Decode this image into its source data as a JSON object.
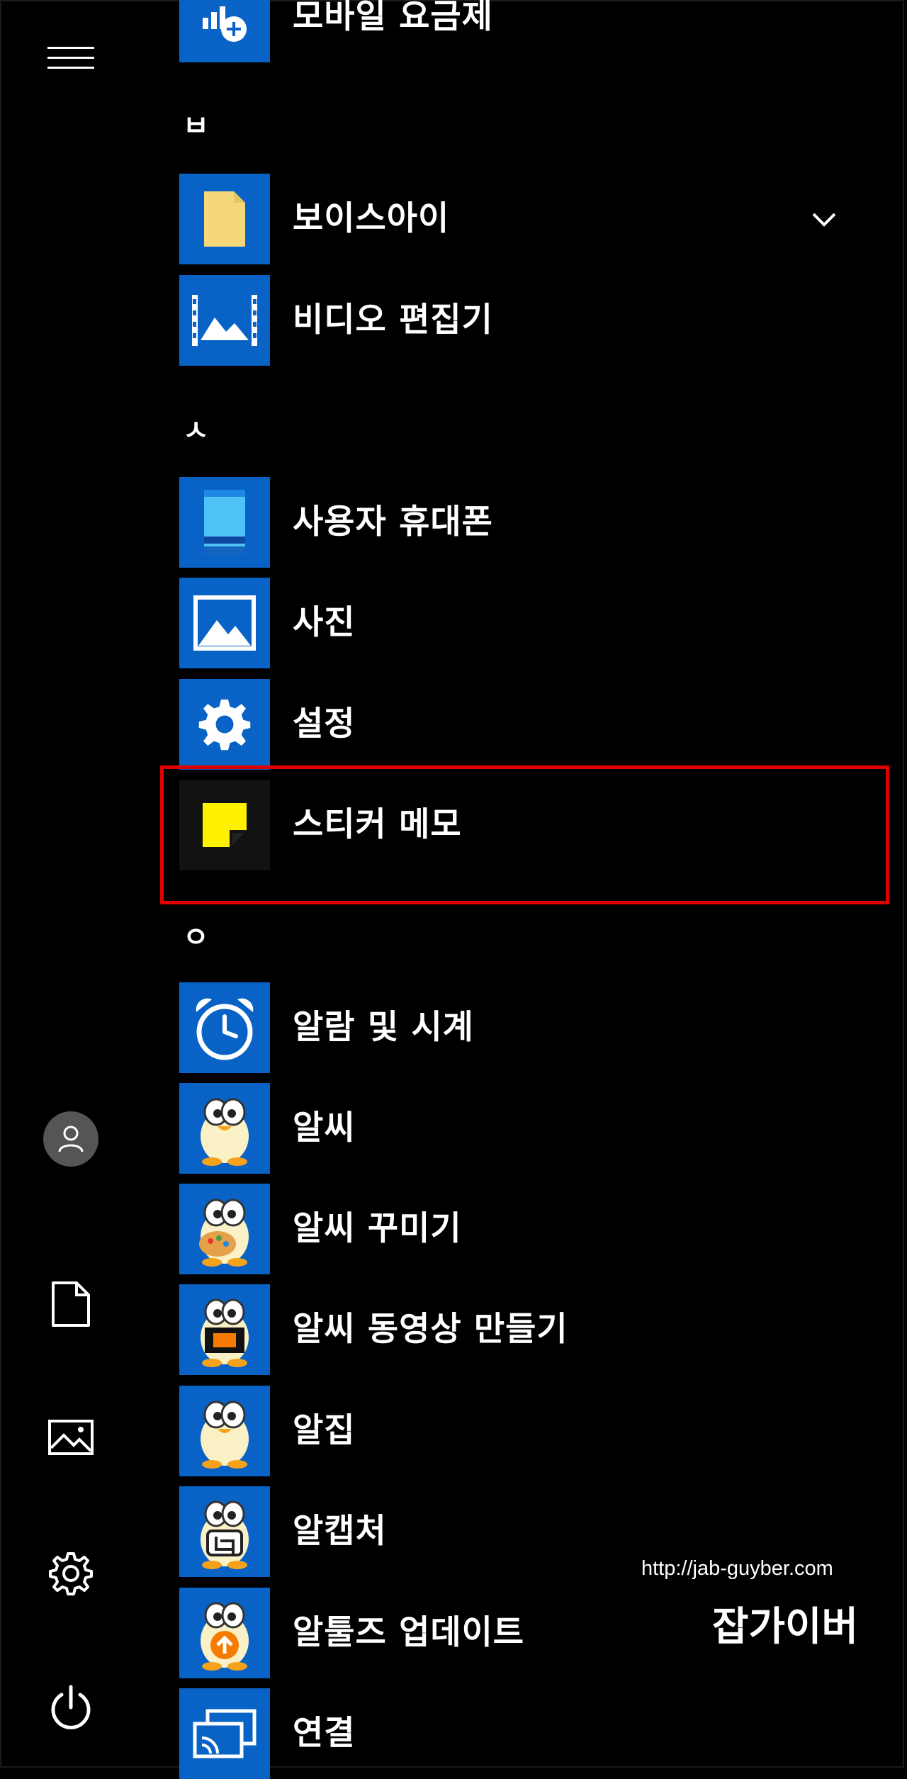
{
  "rail": {
    "menu_icon": "hamburger-icon",
    "account_icon": "user-icon",
    "documents_icon": "document-icon",
    "pictures_icon": "picture-icon",
    "settings_icon": "gear-icon",
    "power_icon": "power-icon"
  },
  "groups": {
    "bieup": "ㅂ",
    "siot": "ㅅ",
    "ieung": "ㅇ"
  },
  "apps": {
    "mobile_plan": "모바일 요금제",
    "voiceeye": "보이스아이",
    "video_editor": "비디오 편집기",
    "your_phone": "사용자 휴대폰",
    "photos": "사진",
    "settings": "설정",
    "sticky_notes": "스티커 메모",
    "alarms_clock": "알람 및 시계",
    "alsee": "알씨",
    "alsee_decorate": "알씨 꾸미기",
    "alsee_video": "알씨 동영상 만들기",
    "alzip": "알집",
    "alcapture": "알캡처",
    "altools_update": "알툴즈 업데이트",
    "connect": "연결"
  },
  "watermark": {
    "url": "http://jab-guyber.com",
    "name": "잡가이버"
  },
  "colors": {
    "tile_blue": "#0963c7",
    "highlight_red": "#e00000",
    "background": "#000000"
  }
}
